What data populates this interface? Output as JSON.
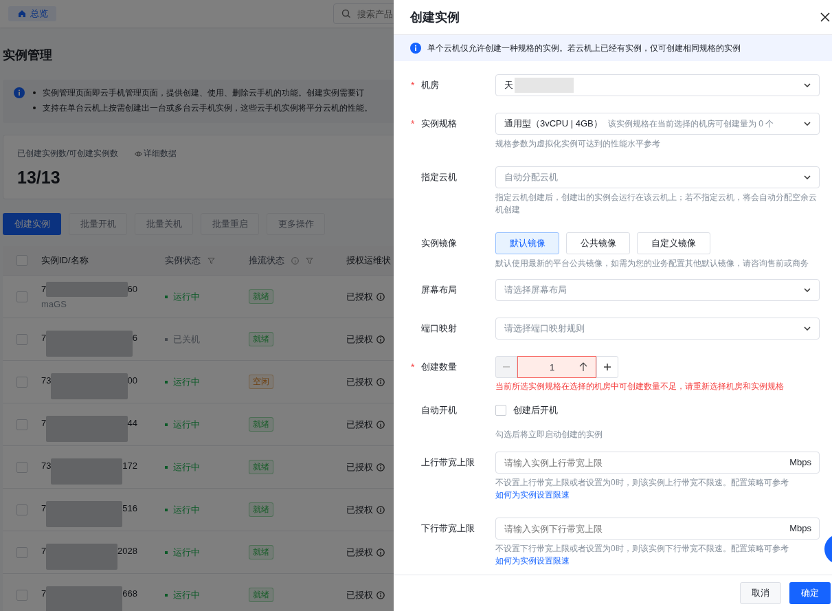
{
  "topbar": {
    "home_tab": "总览",
    "search": {
      "placeholder": "搜索产品"
    }
  },
  "page_title": "实例管理",
  "notice": [
    "实例管理页面即云手机管理页面，提供创建、使用、删除云手机的功能。创建实例需要订",
    "支持在单台云机上按需创建出一台或多台云手机实例，这些云手机实例将平分云机的性能。"
  ],
  "stats": {
    "label": "已创建实例数/可创建实例数",
    "detail_link": "详细数据",
    "value": "13/13"
  },
  "actions": [
    {
      "label": "创建实例",
      "disabled": false
    },
    {
      "label": "批量开机",
      "disabled": true
    },
    {
      "label": "批量关机",
      "disabled": true
    },
    {
      "label": "批量重启",
      "disabled": true
    },
    {
      "label": "更多操作",
      "disabled": true
    }
  ],
  "table": {
    "all_checked": false,
    "columns": [
      {
        "label": "实例ID/名称"
      },
      {
        "label": "实例状态",
        "filter": true
      },
      {
        "label": "推流状态",
        "info": true,
        "filter": true
      },
      {
        "label": "授权运维状"
      }
    ],
    "rows": [
      {
        "checked": false,
        "id_start": "7",
        "id_end": "60",
        "name": "maGS",
        "status": "运行中",
        "color": "#0b5a27",
        "stream": {
          "text": "就绪",
          "color": "#155c26"
        },
        "auth": "已授权"
      },
      {
        "checked": false,
        "id_start": "7",
        "id_end": "6",
        "status": "已关机",
        "color": "#44484e",
        "stream": {
          "text": "就绪",
          "color": "#155c26"
        },
        "auth": "已授权"
      },
      {
        "checked": false,
        "id_start": "73",
        "id_end": "00",
        "status": "运行中",
        "color": "#0b5a27",
        "stream": {
          "text": "空闲",
          "color": "#6e4010"
        },
        "auth": "已授权"
      },
      {
        "checked": false,
        "id_start": "7",
        "id_end": "44",
        "status": "运行中",
        "color": "#0b5a27",
        "stream": {
          "text": "就绪",
          "color": "#155c26"
        },
        "auth": "已授权"
      },
      {
        "checked": false,
        "id_start": "73",
        "id_end": "172",
        "status": "运行中",
        "color": "#0b5a27",
        "stream": {
          "text": "就绪",
          "color": "#155c26"
        },
        "auth": "已授权"
      },
      {
        "checked": false,
        "id_start": "7",
        "id_end": "516",
        "status": "运行中",
        "color": "#0b5a27",
        "stream": {
          "text": "就绪",
          "color": "#155c26"
        },
        "auth": "已授权"
      },
      {
        "checked": false,
        "id_start": "7",
        "id_end": "2028",
        "status": "运行中",
        "color": "#0b5a27",
        "stream": {
          "text": "就绪",
          "color": "#155c26"
        },
        "auth": "已授权"
      },
      {
        "checked": false,
        "id_start": "7",
        "id_end": "668",
        "status": "运行中",
        "color": "#0b5a27",
        "stream": {
          "text": "就绪",
          "color": "#155c26"
        },
        "auth": "已授权"
      }
    ]
  },
  "drawer": {
    "title": "创建实例",
    "notice": "单个云机仅允许创建一种规格的实例。若云机上已经有实例，仅可创建相同规格的实例",
    "fields": [
      {
        "kind": "select",
        "required_mark": "*",
        "label": "机房",
        "value": "天",
        "redacted": true
      },
      {
        "kind": "select",
        "required_mark": "*",
        "label": "实例规格",
        "value": "通用型（3vCPU | 4GB）",
        "note": "该实例规格在当前选择的机房可创建量为 0 个",
        "help": "规格参数为虚拟化实例可达到的性能水平参考"
      },
      {
        "kind": "select",
        "label": "指定云机",
        "placeholder": "自动分配云机",
        "help": "指定云机创建后，创建出的实例会运行在该云机上；若不指定云机，将会自动分配空余云机创建"
      },
      {
        "kind": "segmented",
        "label": "实例镜像",
        "options": [
          {
            "label": "默认镜像",
            "selected": true
          },
          {
            "label": "公共镜像",
            "selected": false
          },
          {
            "label": "自定义镜像",
            "selected": false
          }
        ],
        "help": "默认使用最新的平台公共镜像，如需为您的业务配置其他默认镜像，请咨询售前或商务"
      },
      {
        "kind": "select",
        "label": "屏幕布局",
        "placeholder": "请选择屏幕布局"
      },
      {
        "kind": "select",
        "label": "端口映射",
        "placeholder": "请选择端口映射规则"
      },
      {
        "kind": "number",
        "required_mark": "*",
        "label": "创建数量",
        "value": "1",
        "error": "当前所选实例规格在选择的机房中可创建数量不足，请重新选择机房和实例规格"
      },
      {
        "kind": "checkbox",
        "label": "自动开机",
        "option": "创建后开机",
        "checked": false,
        "help": "勾选后将立即启动创建的实例"
      },
      {
        "kind": "unit",
        "label": "上行带宽上限",
        "placeholder": "请输入实例上行带宽上限",
        "unit": "Mbps",
        "help": "不设置上行带宽上限或者设置为0时，则该实例上行带宽不限速。配置策略可参考",
        "link": "如何为实例设置限速"
      },
      {
        "kind": "unit",
        "label": "下行带宽上限",
        "placeholder": "请输入实例下行带宽上限",
        "unit": "Mbps",
        "help": "不设置下行带宽上限或者设置为0时，则该实例下行带宽不限速。配置策略可参考",
        "link": "如何为实例设置限速"
      }
    ],
    "buttons": [
      {
        "label": "取消",
        "primary": false
      },
      {
        "label": "确定",
        "primary": true
      }
    ]
  }
}
